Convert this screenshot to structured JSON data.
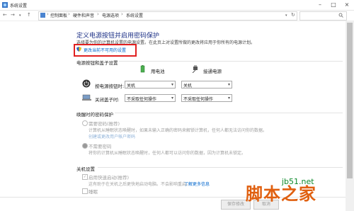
{
  "window": {
    "title": "系统设置",
    "icon": "control-panel-icon"
  },
  "nav": {
    "back": "←",
    "forward": "→",
    "up": "↑",
    "refresh": "↻"
  },
  "breadcrumb": [
    "控制面板",
    "硬件和声音",
    "电源选项",
    "系统设置"
  ],
  "page": {
    "title": "定义电源按钮并启用密码保护",
    "description": "选择要为你的计算机设置的电源设置。在此页上对设置所做的更改将应用于你所有的电源计划。",
    "change_link": "更改当前不可用的设置"
  },
  "power_buttons": {
    "heading": "电源按钮和盖子设置",
    "col_battery": "用电池",
    "col_plugged": "接通电源",
    "rows": [
      {
        "label": "按电源按钮时:",
        "battery": "关机",
        "plugged": "关机",
        "icon": "power-button-icon"
      },
      {
        "label": "关闭盖子时:",
        "battery": "不采取任何操作",
        "plugged": "不采取任何操作",
        "icon": "lid-icon"
      }
    ]
  },
  "wake_password": {
    "heading": "唤醒时的密码保护",
    "option1_title": "需要密码(推荐)",
    "option1_desc1": "计算机从睡眠状态唤醒时，如果未输入正确的密码来解锁计算机，任何人都无法访问你的数据。",
    "option1_link": "创建或更改用户帐户密码",
    "option2_title": "不需要密码",
    "option2_desc": "将你的计算机从睡眠状态唤醒时，任何人都可以访问你的数据，因为计算机未锁定。"
  },
  "shutdown": {
    "heading": "关机设置",
    "fast_startup": "启用快速启动(推荐)",
    "fast_startup_desc": "这有助于在关机之后更快地启动电脑。不会影响重启。",
    "learn_more": "了解更多信息",
    "hibernate": "睡眠"
  },
  "footer": {
    "save": "保存修改",
    "cancel": "取消"
  },
  "watermark": {
    "main": "脚本之家",
    "url": "jb51.net"
  }
}
